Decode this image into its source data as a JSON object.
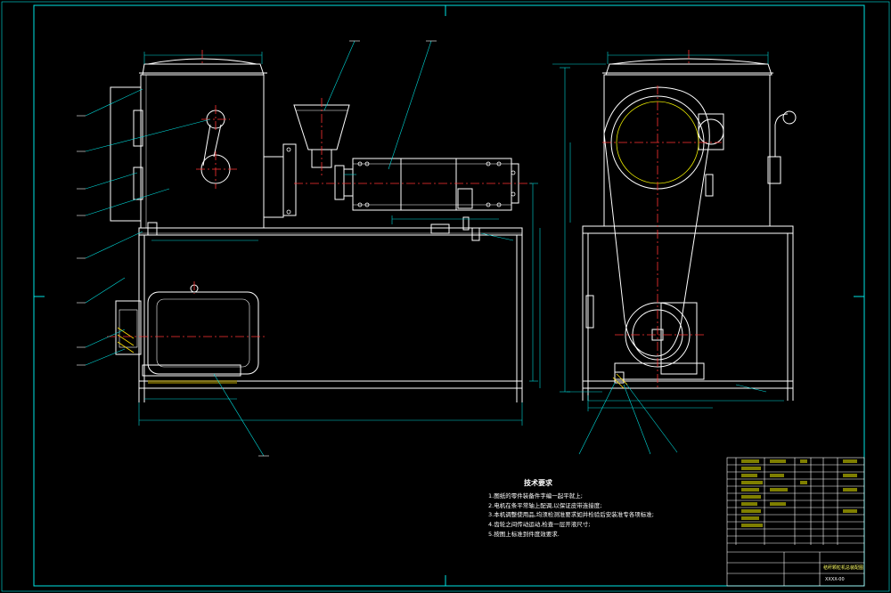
{
  "notes": {
    "title": "技术要求",
    "items": [
      "1.图纸的零件装备件字编一起平就上;",
      "2.电机在条平常轴上配调,以保证皮带连接度;",
      "3.本机调整使用品,均须检测准要求如并检验后安装准专各项标准;",
      "4.齿轮之间传动运动,检查一层开液尺寸;",
      "5.按图上标准到件度效要求."
    ]
  },
  "title_block": {
    "drawing_name": "秸秆颗粒机总装配图",
    "code": "XXXX-00"
  },
  "colors": {
    "frame": "#00e5e5",
    "outline": "#ffffff",
    "center": "#ff3333",
    "dim": "#00d8d8",
    "pulley": "#e8e800",
    "hatch": "#ffe000"
  }
}
